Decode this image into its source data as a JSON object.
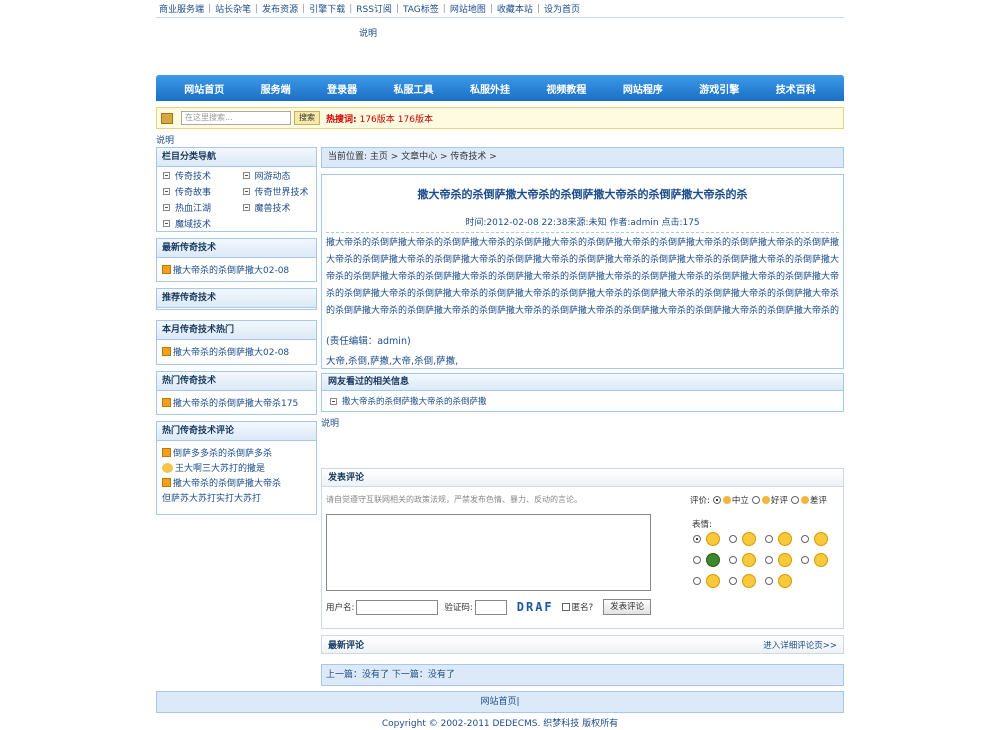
{
  "topbar": {
    "links": [
      "商业服务端",
      "站长杂笔",
      "发布资源",
      "引擎下载",
      "RSS订阅",
      "TAG标签",
      "网站地图",
      "收藏本站",
      "设为首页"
    ]
  },
  "ad_note": "说明",
  "nav": [
    "网站首页",
    "服务端",
    "登录器",
    "私服工具",
    "私服外挂",
    "视频教程",
    "网站程序",
    "游戏引擎",
    "技术百科"
  ],
  "search": {
    "placeholder": "在这里搜索...",
    "button": "搜索",
    "hot_label": "热搜词:",
    "hot_words": [
      "176版本",
      "176版本"
    ]
  },
  "note2": "说明",
  "sidebar": {
    "category": {
      "title": "栏目分类导航",
      "items": [
        "传奇技术",
        "网游动态",
        "传奇故事",
        "传奇世界技术",
        "热血江湖",
        "魔兽技术",
        "魔域技术"
      ]
    },
    "latest": {
      "title": "最新传奇技术",
      "items": [
        "撒大帝杀的杀倒萨撒大02-08"
      ]
    },
    "recommend": {
      "title": "推荐传奇技术"
    },
    "month_hot": {
      "title": "本月传奇技术热门",
      "items": [
        "撒大帝杀的杀倒萨撒大02-08"
      ]
    },
    "hot": {
      "title": "热门传奇技术",
      "items": [
        "撒大帝杀的杀倒萨撒大帝杀175"
      ]
    },
    "hot_comments": {
      "title": "热门传奇技术评论",
      "items": [
        "倒萨多多杀的杀倒萨多杀",
        "王大啊三大苏打的撒是",
        "撒大帝杀的杀倒萨撒大帝杀",
        "但萨苏大苏打实打大苏打"
      ]
    }
  },
  "crumb": "当前位置: 主页 > 文章中心 > 传奇技术 >",
  "article": {
    "title": "撒大帝杀的杀倒萨撒大帝杀的杀倒萨撒大帝杀的杀倒萨撒大帝杀的杀",
    "meta": "时间:2012-02-08 22:38来源:未知 作者:admin 点击:175",
    "body": "撒大帝杀的杀倒萨撒大帝杀的杀倒萨撒大帝杀的杀倒萨撒大帝杀的杀倒萨撒大帝杀的杀倒萨撒大帝杀的杀倒萨撒大帝杀的杀倒萨撒大帝杀的杀倒萨撒大帝杀的杀倒萨撒大帝杀的杀倒萨撒大帝杀的杀倒萨撒大帝杀的杀倒萨撒大帝杀的杀倒萨撒大帝杀的杀倒萨撒大帝杀的杀倒萨撒大帝杀的杀倒萨撒大帝杀的杀倒萨撒大帝杀的杀倒萨撒大帝杀的杀倒萨撒大帝杀的杀倒萨撒大帝杀的杀倒萨撒大帝杀的杀倒萨撒大帝杀的杀倒萨撒大帝杀的杀倒萨撒大帝杀的杀倒萨撒大帝杀的杀倒萨撒大帝杀的杀倒萨撒大帝杀的杀倒萨撒大帝杀的杀倒萨撒大帝杀的杀倒萨撒大帝杀的杀倒萨撒大帝杀的杀倒萨撒大帝杀的杀倒萨撒大帝杀的杀倒萨撒大帝杀的杀倒萨撒大帝杀的杀倒萨",
    "editor": "(责任编辑：admin)",
    "tags": "大帝,杀倒,萨撒,大帝,杀倒,萨撒,"
  },
  "related": {
    "title": "网友看过的相关信息",
    "items": [
      "撒大帝杀的杀倒萨撒大帝杀的杀倒萨撒"
    ]
  },
  "note3": "说明",
  "comment_form": {
    "title": "发表评论",
    "notice": "请自觉遵守互联网相关的政策法规，严禁发布色情、暴力、反动的言论。",
    "rating_label": "评价:",
    "ratings": [
      "中立",
      "好评",
      "差评"
    ],
    "expression_label": "表情:",
    "username_label": "用户名:",
    "captcha_label": "验证码:",
    "captcha_text": "DRAF",
    "anonymous_label": "匿名?",
    "submit": "发表评论"
  },
  "latest_comments": {
    "title": "最新评论",
    "more": "进入详细评论页>>"
  },
  "prevnext": "上一篇：没有了 下一篇：没有了",
  "footer": {
    "link": "网站首页|"
  },
  "copyright": "Copyright © 2002-2011 DEDECMS. 织梦科技 版权所有",
  "colors": {
    "nav": "#1a6fc4",
    "link": "#1d4d8c",
    "box_border": "#a8c8ea",
    "hot": "#cc0000"
  }
}
